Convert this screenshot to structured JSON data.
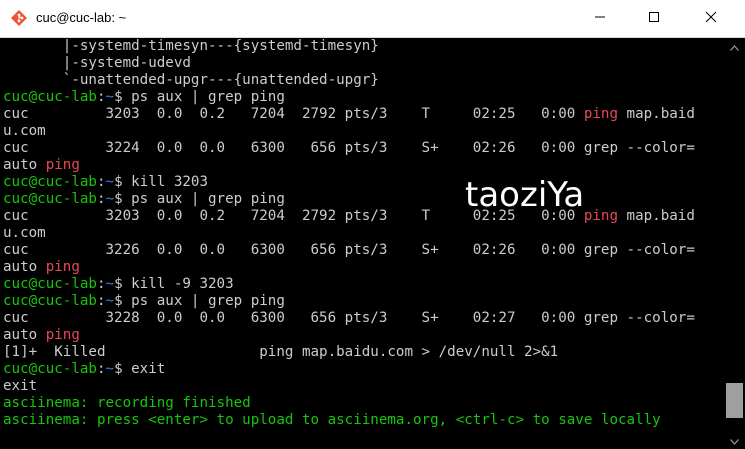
{
  "window": {
    "title": "cuc@cuc-lab: ~",
    "app_icon": "git-bash-icon",
    "controls": {
      "minimize_icon": "minimize-icon",
      "maximize_icon": "maximize-icon",
      "close_icon": "close-icon"
    }
  },
  "colors": {
    "prompt_user": "#16c60c",
    "prompt_path": "#3b78ff",
    "highlight": "#e74856",
    "text": "#cccccc",
    "background": "#000000"
  },
  "terminal": {
    "lines": [
      {
        "segments": [
          {
            "text": "       |-systemd-timesyn---{systemd-timesyn}"
          }
        ]
      },
      {
        "segments": [
          {
            "text": "       |-systemd-udevd"
          }
        ]
      },
      {
        "segments": [
          {
            "text": "       `-unattended-upgr---{unattended-upgr}"
          }
        ]
      },
      {
        "segments": [
          {
            "text": "cuc@cuc-lab",
            "style": "prompt-user"
          },
          {
            "text": ":"
          },
          {
            "text": "~",
            "style": "prompt-path"
          },
          {
            "text": "$ ps aux | grep ping"
          }
        ]
      },
      {
        "segments": [
          {
            "text": "cuc         3203  0.0  0.2   7204  2792 pts/3    T     02:25   0:00 "
          },
          {
            "text": "ping",
            "style": "hl-red"
          },
          {
            "text": " map.baid"
          }
        ]
      },
      {
        "segments": [
          {
            "text": "u.com"
          }
        ]
      },
      {
        "segments": [
          {
            "text": "cuc         3224  0.0  0.0   6300   656 pts/3    S+    02:26   0:00 grep --color="
          }
        ]
      },
      {
        "segments": [
          {
            "text": "auto "
          },
          {
            "text": "ping",
            "style": "hl-red"
          }
        ]
      },
      {
        "segments": [
          {
            "text": "cuc@cuc-lab",
            "style": "prompt-user"
          },
          {
            "text": ":"
          },
          {
            "text": "~",
            "style": "prompt-path"
          },
          {
            "text": "$ kill 3203"
          }
        ]
      },
      {
        "segments": [
          {
            "text": "cuc@cuc-lab",
            "style": "prompt-user"
          },
          {
            "text": ":"
          },
          {
            "text": "~",
            "style": "prompt-path"
          },
          {
            "text": "$ ps aux | grep ping"
          }
        ]
      },
      {
        "segments": [
          {
            "text": "cuc         3203  0.0  0.2   7204  2792 pts/3    T     02:25   0:00 "
          },
          {
            "text": "ping",
            "style": "hl-red"
          },
          {
            "text": " map.baid"
          }
        ]
      },
      {
        "segments": [
          {
            "text": "u.com"
          }
        ]
      },
      {
        "segments": [
          {
            "text": "cuc         3226  0.0  0.0   6300   656 pts/3    S+    02:26   0:00 grep --color="
          }
        ]
      },
      {
        "segments": [
          {
            "text": "auto "
          },
          {
            "text": "ping",
            "style": "hl-red"
          }
        ]
      },
      {
        "segments": [
          {
            "text": "cuc@cuc-lab",
            "style": "prompt-user"
          },
          {
            "text": ":"
          },
          {
            "text": "~",
            "style": "prompt-path"
          },
          {
            "text": "$ kill -9 3203"
          }
        ]
      },
      {
        "segments": [
          {
            "text": "cuc@cuc-lab",
            "style": "prompt-user"
          },
          {
            "text": ":"
          },
          {
            "text": "~",
            "style": "prompt-path"
          },
          {
            "text": "$ ps aux | grep ping"
          }
        ]
      },
      {
        "segments": [
          {
            "text": "cuc         3228  0.0  0.0   6300   656 pts/3    S+    02:27   0:00 grep --color="
          }
        ]
      },
      {
        "segments": [
          {
            "text": "auto "
          },
          {
            "text": "ping",
            "style": "hl-red"
          }
        ]
      },
      {
        "segments": [
          {
            "text": "[1]+  Killed                  ping map.baidu.com > /dev/null 2>&1"
          }
        ]
      },
      {
        "segments": [
          {
            "text": "cuc@cuc-lab",
            "style": "prompt-user"
          },
          {
            "text": ":"
          },
          {
            "text": "~",
            "style": "prompt-path"
          },
          {
            "text": "$ exit"
          }
        ]
      },
      {
        "segments": [
          {
            "text": "exit"
          }
        ]
      },
      {
        "segments": [
          {
            "text": "asciinema: recording finished",
            "style": "green"
          }
        ]
      },
      {
        "segments": [
          {
            "text": "asciinema: press <enter> to upload to asciinema.org, <ctrl-c> to save locally",
            "style": "green"
          }
        ]
      }
    ]
  },
  "watermark": {
    "text": "taoziYa"
  },
  "scrollbar": {
    "up_icon": "scroll-up-arrow-icon",
    "down_icon": "scroll-down-arrow-icon",
    "position": 0.92
  }
}
